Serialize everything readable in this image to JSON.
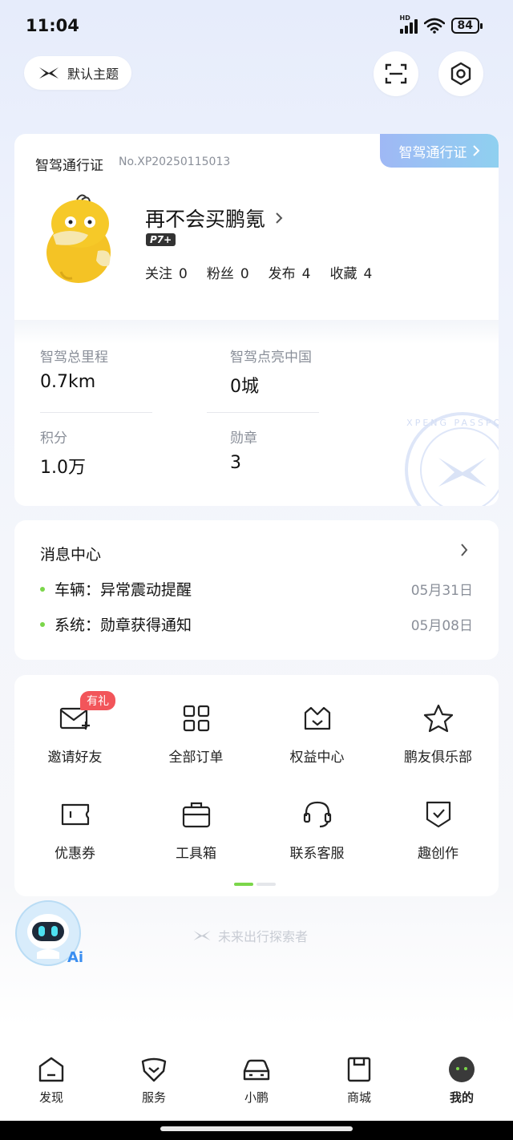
{
  "status": {
    "time": "11:04",
    "network": "HD",
    "battery": "84"
  },
  "header": {
    "theme_label": "默认主题",
    "scan_icon": "scan-icon",
    "settings_icon": "settings-icon"
  },
  "passport": {
    "tab_label": "智驾通行证",
    "title": "智驾通行证",
    "number": "No.XP20250115013",
    "nickname": "再不会买鹏氪",
    "model_badge": "P7+",
    "stats": [
      {
        "label": "关注",
        "value": "0"
      },
      {
        "label": "粉丝",
        "value": "0"
      },
      {
        "label": "发布",
        "value": "4"
      },
      {
        "label": "收藏",
        "value": "4"
      }
    ],
    "metrics": [
      {
        "label": "智驾总里程",
        "value": "0.7km"
      },
      {
        "label": "智驾点亮中国",
        "value": "0城"
      },
      {
        "label": "积分",
        "value": "1.0万"
      },
      {
        "label": "勋章",
        "value": "3"
      }
    ],
    "stamp_text": "XPENG PASSPORT"
  },
  "messages": {
    "title": "消息中心",
    "items": [
      {
        "text": "车辆：异常震动提醒",
        "date": "05月31日"
      },
      {
        "text": "系统：勋章获得通知",
        "date": "05月08日"
      }
    ]
  },
  "services": {
    "gift_badge": "有礼",
    "items": [
      {
        "label": "邀请好友",
        "icon": "invite-mail-icon"
      },
      {
        "label": "全部订单",
        "icon": "grid-icon"
      },
      {
        "label": "权益中心",
        "icon": "benefits-basket-icon"
      },
      {
        "label": "鹏友俱乐部",
        "icon": "star-icon"
      },
      {
        "label": "优惠券",
        "icon": "coupon-icon"
      },
      {
        "label": "工具箱",
        "icon": "toolbox-icon"
      },
      {
        "label": "联系客服",
        "icon": "headset-icon"
      },
      {
        "label": "趣创作",
        "icon": "create-shield-icon"
      }
    ]
  },
  "slogan": "未来出行探索者",
  "ai_label": "Ai",
  "tabs": [
    {
      "label": "发现",
      "icon": "discover-icon"
    },
    {
      "label": "服务",
      "icon": "service-icon"
    },
    {
      "label": "小鹏",
      "icon": "car-icon"
    },
    {
      "label": "商城",
      "icon": "mall-icon"
    },
    {
      "label": "我的",
      "icon": "profile-avatar-icon",
      "active": true
    }
  ],
  "colors": {
    "accent_green": "#7bd64a",
    "badge_red": "#f2555a",
    "tab_gradient_start": "#9fb8f5",
    "tab_gradient_end": "#8fd0f0"
  }
}
